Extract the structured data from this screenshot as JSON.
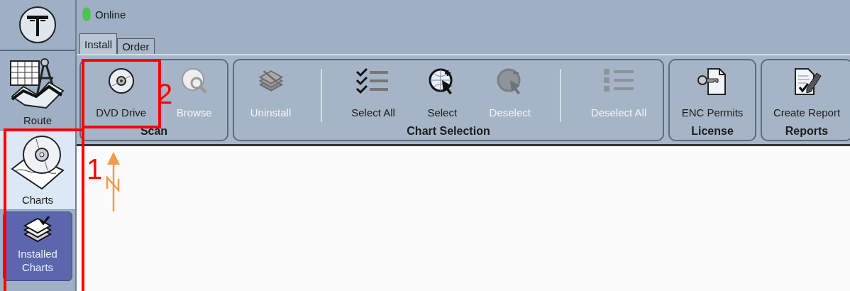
{
  "status": {
    "label": "Online",
    "online": true
  },
  "nav_items": [
    {
      "label": "Route",
      "kind": "section",
      "selected": false
    },
    {
      "label": "Charts",
      "kind": "section",
      "selected": true
    },
    {
      "label": "Installed Charts",
      "kind": "sub",
      "selected": true
    }
  ],
  "tabs": [
    {
      "label": "Install",
      "selected": true
    },
    {
      "label": "Order",
      "selected": false
    }
  ],
  "ribbon_groups": [
    {
      "title": "Scan",
      "buttons": [
        {
          "label": "DVD Drive",
          "disabled": false,
          "divider_after": false
        },
        {
          "label": "Browse",
          "disabled": true,
          "divider_after": false
        }
      ]
    },
    {
      "title": "Chart Selection",
      "buttons": [
        {
          "label": "Uninstall",
          "disabled": true,
          "divider_after": true
        },
        {
          "label": "Select All",
          "disabled": false,
          "divider_after": false
        },
        {
          "label": "Select",
          "disabled": false,
          "divider_after": false
        },
        {
          "label": "Deselect",
          "disabled": true,
          "divider_after": true
        },
        {
          "label": "Deselect All",
          "disabled": true,
          "divider_after": false
        }
      ]
    },
    {
      "title": "License",
      "buttons": [
        {
          "label": "ENC Permits",
          "disabled": false,
          "divider_after": false
        }
      ]
    },
    {
      "title": "Reports",
      "buttons": [
        {
          "label": "Create Report",
          "disabled": false,
          "divider_after": false
        }
      ]
    }
  ],
  "annotations": [
    {
      "label": "1"
    },
    {
      "label": "2"
    }
  ]
}
